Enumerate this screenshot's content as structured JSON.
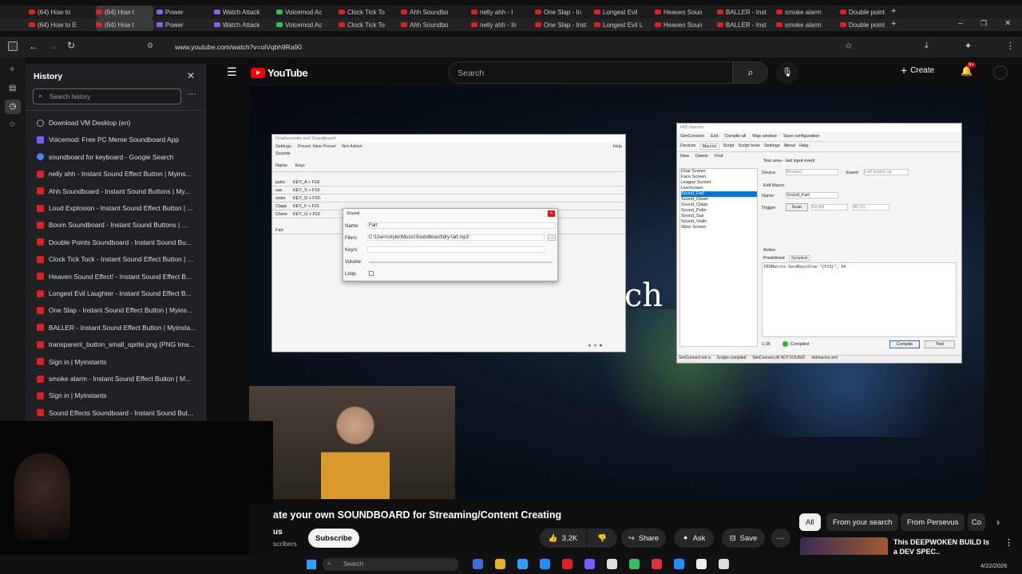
{
  "tabs_row1": [
    {
      "label": "(64) How to"
    },
    {
      "label": "(64) How t"
    },
    {
      "label": "Power"
    },
    {
      "label": "Watch Attack"
    },
    {
      "label": "Voicemod Ac"
    },
    {
      "label": "Clock Tick To"
    },
    {
      "label": "Ahh Soundbo"
    },
    {
      "label": "nelly ahh - I"
    },
    {
      "label": "One Slap - In"
    },
    {
      "label": "Longest Evil"
    },
    {
      "label": "Heaven Soun"
    },
    {
      "label": "BALLER - Inst"
    },
    {
      "label": "smoke alarm"
    },
    {
      "label": "Double point"
    }
  ],
  "tabs_row2": [
    {
      "label": "(64) How to E"
    },
    {
      "label": "(64) How t"
    },
    {
      "label": "Power"
    },
    {
      "label": "Watch Attack"
    },
    {
      "label": "Voicemod Ac"
    },
    {
      "label": "Clock Tick To"
    },
    {
      "label": "Ahh Soundbo"
    },
    {
      "label": "nelly ahh - In"
    },
    {
      "label": "One Slap - Inst"
    },
    {
      "label": "Longest Evil L"
    },
    {
      "label": "Heaven Soun"
    },
    {
      "label": "BALLER - Inst"
    },
    {
      "label": "smoke alarm"
    },
    {
      "label": "Double point"
    }
  ],
  "address": {
    "url": "www.youtube.com/watch?v=olVqbh9Ra90"
  },
  "notification_badge": "9+",
  "history": {
    "title": "History",
    "search_placeholder": "Search history",
    "items": [
      {
        "label": "Download VM Desktop (en)",
        "icon": "globe-icon"
      },
      {
        "label": "Voicemod: Free PC Meme Soundboard App",
        "icon": "voicemod-icon"
      },
      {
        "label": "soundboard for keyboard - Google Search",
        "icon": "google-icon"
      },
      {
        "label": "nelly ahh - Instant Sound Effect Button | Myins...",
        "icon": "myinstants-icon"
      },
      {
        "label": "Ahh Soundboard - Instant Sound Buttons | My...",
        "icon": "myinstants-icon"
      },
      {
        "label": "Loud Explosion - Instant Sound Effect Button | ...",
        "icon": "myinstants-icon"
      },
      {
        "label": "Boom Soundboard - Instant Sound Buttons | ...",
        "icon": "myinstants-icon"
      },
      {
        "label": "Double Points Soundboard - Instant Sound Bu...",
        "icon": "myinstants-icon"
      },
      {
        "label": "Clock Tick Tock - Instant Sound Effect Button | ...",
        "icon": "myinstants-icon"
      },
      {
        "label": "Heaven Sound Effect! - Instant Sound Effect B...",
        "icon": "myinstants-icon"
      },
      {
        "label": "Longest Evil Laughter - Instant Sound Effect B...",
        "icon": "myinstants-icon"
      },
      {
        "label": "One Slap - Instant Sound Effect Button | Myins...",
        "icon": "myinstants-icon"
      },
      {
        "label": "BALLER - Instant Sound Effect Button | Myinsta...",
        "icon": "myinstants-icon"
      },
      {
        "label": "transparent_button_small_sprite.png (PNG Ima...",
        "icon": "myinstants-icon"
      },
      {
        "label": "Sign in | Myinstants",
        "icon": "myinstants-icon"
      },
      {
        "label": "smoke alarm - Instant Sound Effect Button | M...",
        "icon": "myinstants-icon"
      },
      {
        "label": "Sign in | Myinstants",
        "icon": "myinstants-icon"
      },
      {
        "label": "Sound Effects Soundboard - Instant Sound But...",
        "icon": "myinstants-icon"
      }
    ]
  },
  "youtube": {
    "logo_text": "YouTube",
    "search_placeholder": "Search",
    "create_label": "Create",
    "video_title": "ate your own SOUNDBOARD for Streaming/Content Creating",
    "channel_partial": "us",
    "subscribers_partial": "scribers",
    "subscribe_label": "Subscribe",
    "like_count": "3.2K",
    "share_label": "Share",
    "ask_label": "Ask",
    "save_label": "Save",
    "chips": [
      "All",
      "From your search",
      "From Persevus",
      "Co"
    ],
    "rec_title": "This DEEPWOKEN BUILD Is a DEV SPEC..",
    "overlay_text": "ch"
  },
  "soundboard_app": {
    "title": "Deathcounter and Soundboard",
    "menu": [
      "Settings",
      "Preset: New Preset",
      "Not Admin",
      "Help"
    ],
    "section": "Sounds",
    "columns": [
      "Name",
      "Keys"
    ],
    "rows": [
      {
        "name": "putin",
        "keys": "KEY_A + F18"
      },
      {
        "name": "sax",
        "keys": "KEY_S + F19"
      },
      {
        "name": "violin",
        "keys": "KEY_D + F20"
      },
      {
        "name": "Clapp",
        "keys": "KEY_F + F21"
      },
      {
        "name": "Cheer",
        "keys": "KEY_G + F22"
      },
      {
        "name": "Fart",
        "keys": ""
      }
    ],
    "dialog": {
      "title": "Sound",
      "name_label": "Name:",
      "name_value": "Fart",
      "file_label": "File/s:",
      "file_value": "C:\\Users\\styler\\Music\\Soundboard\\dry-fart.mp3",
      "keys_label": "Key/s:",
      "volume_label": "Volume:",
      "loop_label": "Loop:"
    }
  },
  "hid_app": {
    "title": "HID macros",
    "toolbar": [
      "SimConnect",
      "Exit",
      "Compile all",
      "Map window",
      "Save configuration"
    ],
    "tabs": [
      "Devices",
      "Macros",
      "Script",
      "Script tools",
      "Settings",
      "About",
      "Help"
    ],
    "sub_toolbar": [
      "New",
      "Delete",
      "Find"
    ],
    "macros": [
      "Chat Screen",
      "Face Screen",
      "League Screen",
      "LiveScreen",
      "Sound_Fart",
      "Sound_Cheer",
      "Sound_Clapp",
      "Sound_Putin",
      "Sound_Sax",
      "Sound_Violin",
      "Xbox Screen"
    ],
    "test_area": "Test area - last input event",
    "device_label": "Device:",
    "device_value": "Mouse1",
    "event_label": "Event:",
    "event_value": "Left button up",
    "edit_macro": "Edit Macro",
    "name_label": "Name:",
    "name_value": "Sound_Fart",
    "trigger_label": "Trigger:",
    "scan_label": "Scan",
    "trigger_value": "Keyb4",
    "trigger_code": "90 (z)",
    "action_label": "Action",
    "action_tabs": [
      "Predefined",
      "Scripted"
    ],
    "script": "HIDMacros.SendKeysSlow \"{F23}\", 50",
    "time": "1:35",
    "compiled": "Compiled",
    "compile_btn": "Compile",
    "test_btn": "Test",
    "status": [
      "SimConnect not a",
      "Scripts compiled",
      "SimConnect.dll NOT FOUND!",
      "hidmacros.xml"
    ]
  },
  "taskbar": {
    "search_placeholder": "Search",
    "date": "4/22/2026"
  },
  "colors": {
    "accent": "#ff0000",
    "bg": "#0f0f0f"
  }
}
